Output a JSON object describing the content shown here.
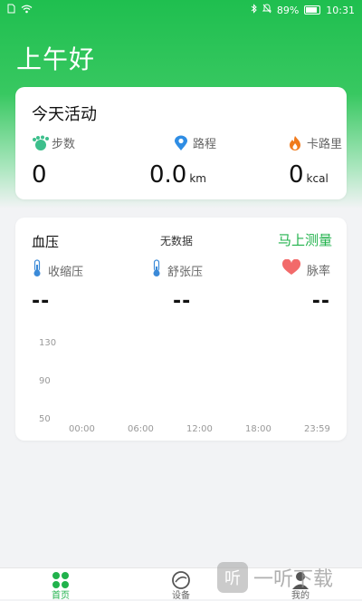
{
  "status_bar": {
    "battery_percent": "89%",
    "time": "10:31"
  },
  "greeting": "上午好",
  "activity": {
    "title": "今天活动",
    "steps_label": "步数",
    "route_label": "路程",
    "calorie_label": "卡路里",
    "steps_value": "0",
    "route_value": "0.0",
    "route_unit": "km",
    "calorie_value": "0",
    "calorie_unit": "kcal"
  },
  "blood_pressure": {
    "title": "血压",
    "no_data": "无数据",
    "measure_button": "马上测量",
    "systolic_label": "收缩压",
    "diastolic_label": "舒张压",
    "pulse_label": "脉率",
    "systolic_value": "--",
    "diastolic_value": "--",
    "pulse_value": "--",
    "y_ticks": [
      "130",
      "90",
      "50"
    ],
    "x_ticks": [
      "00:00",
      "06:00",
      "12:00",
      "18:00",
      "23:59"
    ]
  },
  "tabs": {
    "home": "首页",
    "device": "设备",
    "mine": "我的"
  },
  "watermark": {
    "badge": "听",
    "text": "一听下载"
  },
  "colors": {
    "accent": "#21b24c",
    "header_green": "#1fbf4f"
  }
}
